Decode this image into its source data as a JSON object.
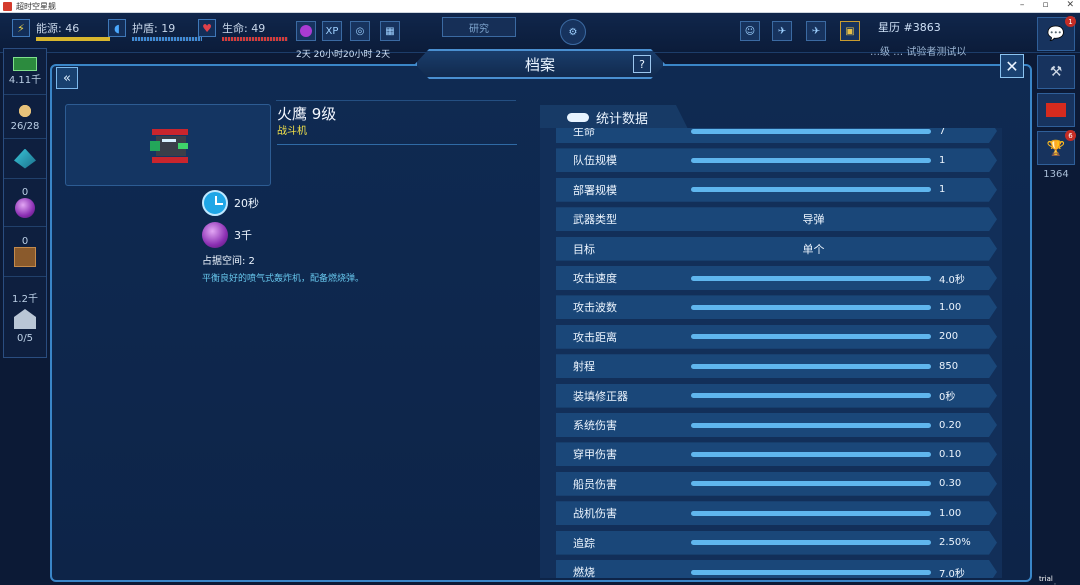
{
  "window": {
    "title": "超时空星舰"
  },
  "hud": {
    "energy_label": "能源: 46",
    "shield_label": "护盾: 19",
    "life_label": "生命: 49",
    "research_label": "研究",
    "timer": "2天 20小时20小时 2天",
    "stardate": "星历 #3863",
    "notice": "…级 … 试验者测试以",
    "chat_badge": "1",
    "trophy_badge": "6",
    "trophy_value": "1364"
  },
  "left_rail": {
    "credits": "4.11千",
    "crew": "26/28",
    "crystal": "0",
    "orb": "0",
    "cargo": "1.2千",
    "slots": "0/5"
  },
  "panel": {
    "title": "档案",
    "help": "?",
    "back": "«",
    "close": "✕"
  },
  "item": {
    "name": "火鹰 9级",
    "type": "战斗机",
    "build_time": "20秒",
    "cost": "3千",
    "space": "占据空间: 2",
    "description": "平衡良好的喷气式轰炸机，配备燃烧弹。"
  },
  "stats": {
    "header": "统计数据",
    "rows": [
      {
        "label": "生命",
        "value": "7",
        "fill": 1
      },
      {
        "label": "队伍规模",
        "value": "1",
        "fill": 1
      },
      {
        "label": "部署规模",
        "value": "1",
        "fill": 1
      },
      {
        "label": "武器类型",
        "value": "导弹",
        "fill": null
      },
      {
        "label": "目标",
        "value": "单个",
        "fill": null
      },
      {
        "label": "攻击速度",
        "value": "4.0秒",
        "fill": 1
      },
      {
        "label": "攻击波数",
        "value": "1.00",
        "fill": 1
      },
      {
        "label": "攻击距离",
        "value": "200",
        "fill": 1
      },
      {
        "label": "射程",
        "value": "850",
        "fill": 1
      },
      {
        "label": "装填修正器",
        "value": "0秒",
        "fill": 1
      },
      {
        "label": "系统伤害",
        "value": "0.20",
        "fill": 1
      },
      {
        "label": "穿甲伤害",
        "value": "0.10",
        "fill": 1
      },
      {
        "label": "船员伤害",
        "value": "0.30",
        "fill": 1
      },
      {
        "label": "战机伤害",
        "value": "1.00",
        "fill": 1
      },
      {
        "label": "追踪",
        "value": "2.50%",
        "fill": 1
      },
      {
        "label": "燃烧",
        "value": "7.0秒",
        "fill": 1
      }
    ]
  },
  "watermark": "trial version",
  "colors": {
    "accent": "#3a86c8",
    "bar": "#5fb6ee",
    "type_yellow": "#f2e14a",
    "desc_cyan": "#67c7ec"
  }
}
